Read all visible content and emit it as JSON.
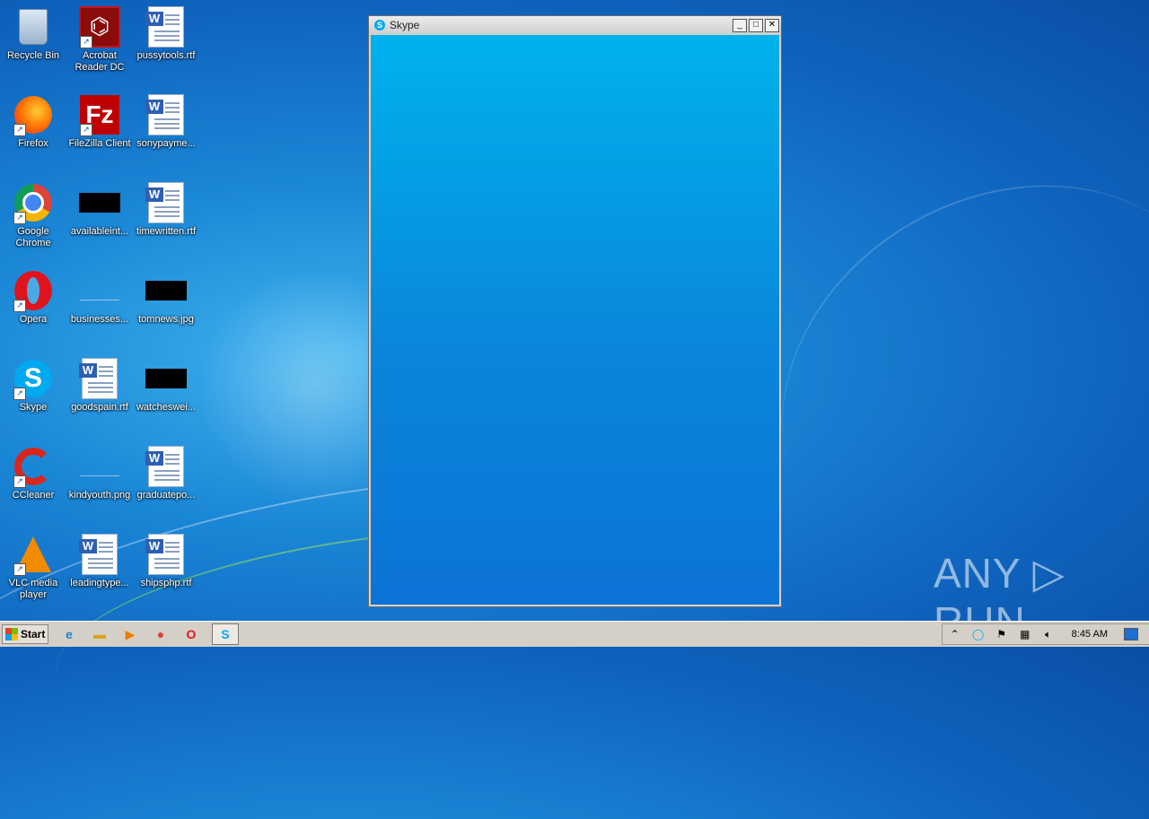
{
  "desktop": {
    "icons": [
      {
        "label": "Recycle Bin",
        "icon": "recycle-bin-icon"
      },
      {
        "label": "Acrobat\nReader DC",
        "icon": "acrobat-reader-icon"
      },
      {
        "label": "pussytools.rtf",
        "icon": "word-document-icon"
      },
      {
        "label": "Firefox",
        "icon": "firefox-icon"
      },
      {
        "label": "FileZilla Client",
        "icon": "filezilla-icon"
      },
      {
        "label": "sonypayme...",
        "icon": "word-document-icon"
      },
      {
        "label": "Google\nChrome",
        "icon": "chrome-icon"
      },
      {
        "label": "availableint...",
        "icon": "black-image-icon"
      },
      {
        "label": "timewritten.rtf",
        "icon": "word-document-icon"
      },
      {
        "label": "Opera",
        "icon": "opera-icon"
      },
      {
        "label": "businesses...",
        "icon": "image-thumbnail-icon"
      },
      {
        "label": "tomnews.jpg",
        "icon": "black-image-icon"
      },
      {
        "label": "Skype",
        "icon": "skype-icon"
      },
      {
        "label": "goodspain.rtf",
        "icon": "word-document-icon"
      },
      {
        "label": "watcheswei...",
        "icon": "black-image-icon"
      },
      {
        "label": "CCleaner",
        "icon": "ccleaner-icon"
      },
      {
        "label": "kindyouth.png",
        "icon": "image-thumbnail-icon"
      },
      {
        "label": "graduatepo...",
        "icon": "word-document-icon"
      },
      {
        "label": "VLC media\nplayer",
        "icon": "vlc-icon"
      },
      {
        "label": "leadingtype...",
        "icon": "word-document-icon"
      },
      {
        "label": "shipsphp.rtf",
        "icon": "word-document-icon"
      }
    ]
  },
  "skype_window": {
    "title": "Skype",
    "minimize": "_",
    "maximize": "□",
    "close": "✕"
  },
  "watermark": "ANY ▷ RUN",
  "taskbar": {
    "start_label": "Start",
    "pinned": [
      "internet-explorer-icon",
      "folder-icon",
      "media-player-icon",
      "chrome-icon",
      "opera-icon",
      "skype-icon"
    ],
    "clock": "8:45 AM"
  }
}
